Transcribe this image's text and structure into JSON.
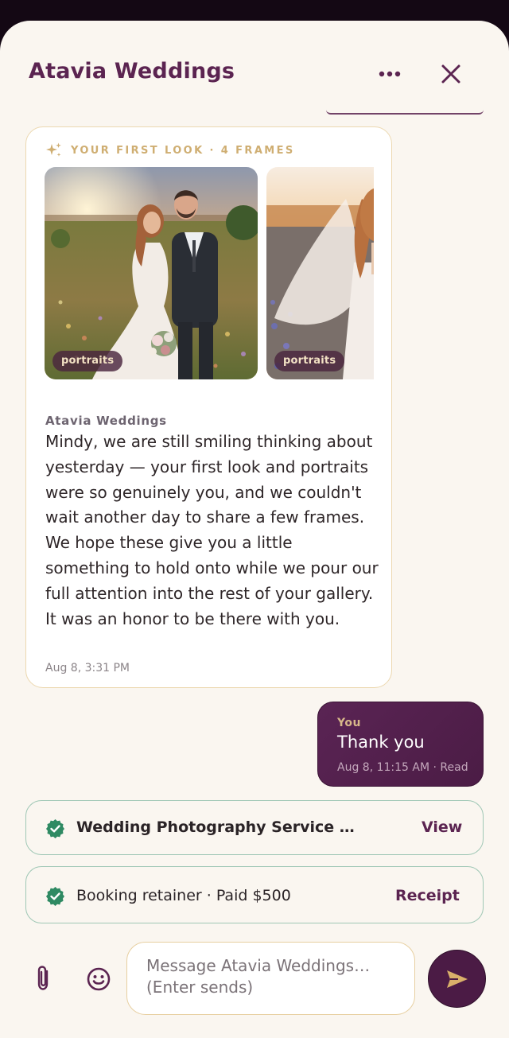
{
  "header": {
    "title": "Atavia Weddings",
    "more_icon": "more-horizontal-icon",
    "close_icon": "close-icon"
  },
  "message": {
    "gallery_label": "YOUR FIRST LOOK · 4 FRAMES",
    "photos": [
      {
        "tag": "portraits"
      },
      {
        "tag": "portraits"
      }
    ],
    "sender": "Atavia Weddings",
    "body": "Mindy, we are still smiling thinking about yesterday — your first look and portraits were so genuinely you, and we couldn't wait another day to share a few frames. We hope these give you a little something to hold onto while we pour our full attention into the rest of your gallery. It was an honor to be there with you.",
    "time": "Aug 8, 3:31 PM"
  },
  "reply": {
    "label": "You",
    "text": "Thank you",
    "meta": "Aug 8, 11:15 AM · Read"
  },
  "rows": [
    {
      "text": "Wedding Photography Service Agreement",
      "action": "View",
      "icon": "check-badge-icon"
    },
    {
      "text": "Booking retainer · Paid $500",
      "action": "Receipt",
      "icon": "check-badge-icon"
    }
  ],
  "composer": {
    "placeholder": "Message Atavia Weddings… (Enter sends)",
    "value": ""
  },
  "colors": {
    "brand": "#5b2451",
    "accent_gold": "#cfae72",
    "success": "#2f8a63",
    "background": "#faf6f0"
  }
}
